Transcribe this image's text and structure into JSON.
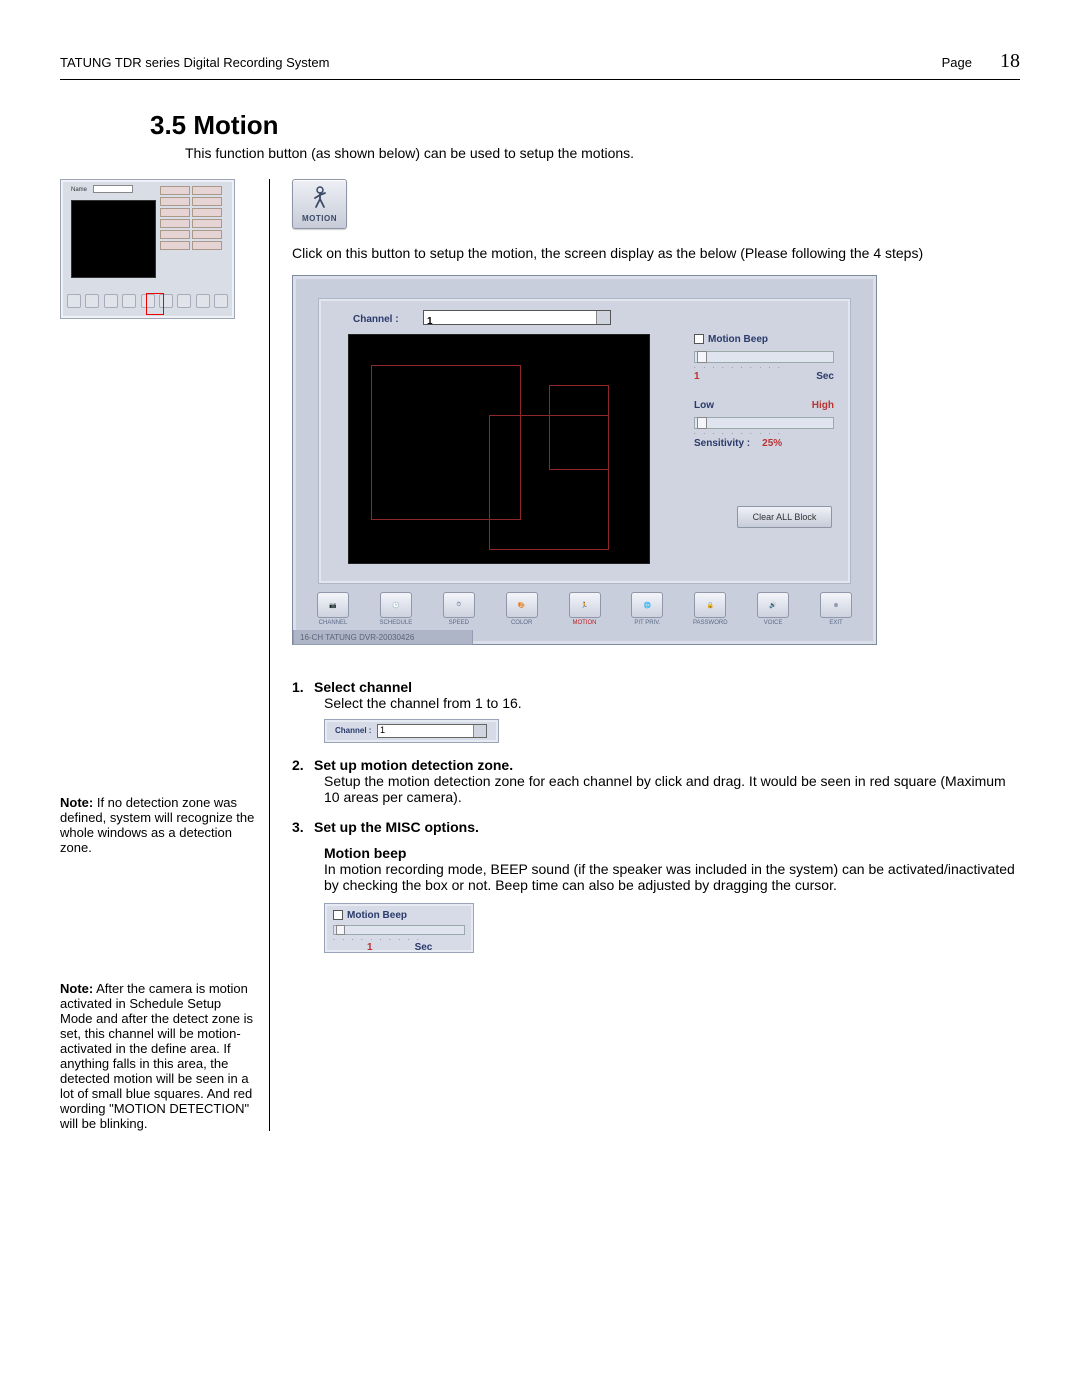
{
  "header": {
    "title": "TATUNG TDR series Digital Recording System",
    "page_label": "Page",
    "page_number": "18"
  },
  "section": {
    "heading": "3.5 Motion",
    "intro": "This function button (as shown below) can be used to setup the motions."
  },
  "motion_button": {
    "label": "MOTION"
  },
  "click_text": "Click on this button to setup the motion, the screen display as the below (Please following the 4 steps)",
  "thumb": {
    "name_label": "Name"
  },
  "big_screenshot": {
    "channel_label": "Channel :",
    "channel_value": "1",
    "motion_beep_label": "Motion Beep",
    "sec_value": "1",
    "sec_label": "Sec",
    "low_label": "Low",
    "high_label": "High",
    "sensitivity_label": "Sensitivity :",
    "sensitivity_value": "25%",
    "clear_button": "Clear ALL Block",
    "toolbar": [
      "CHANNEL",
      "SCHEDULE",
      "SPEED",
      "COLOR",
      "MOTION",
      "PIT PRIV.",
      "PASSWORD",
      "VOICE",
      "EXIT"
    ],
    "footer": "16-CH TATUNG DVR-20030426"
  },
  "steps": {
    "s1": {
      "num": "1.",
      "title": "Select channel",
      "body": "Select the channel from 1 to 16.",
      "crop_label": "Channel :",
      "crop_value": "1"
    },
    "s2": {
      "num": "2.",
      "title": "Set up motion detection zone.",
      "body": "Setup the motion detection zone for each channel by click and drag. It would be seen in red square (Maximum 10 areas per camera)."
    },
    "s3": {
      "num": "3.",
      "title": "Set up the MISC options.",
      "sub": "Motion beep",
      "body": "In motion recording mode, BEEP sound (if the speaker was included in the system) can be activated/inactivated by checking the box or not. Beep time can also be adjusted by dragging the cursor.",
      "crop_beep_label": "Motion Beep",
      "crop_sec_value": "1",
      "crop_sec_label": "Sec"
    }
  },
  "notes": {
    "note1_prefix": "Note:",
    "note1": " If no detection zone was defined, system will recognize the whole windows as a detection zone.",
    "note2_prefix": "Note:",
    "note2": " After the camera is motion activated in Schedule Setup Mode and after the detect zone is set, this channel will be motion-activated in the define area. If anything falls in this area, the detected motion will be seen in a lot of small blue squares. And red wording \"MOTION DETECTION\" will be blinking."
  }
}
